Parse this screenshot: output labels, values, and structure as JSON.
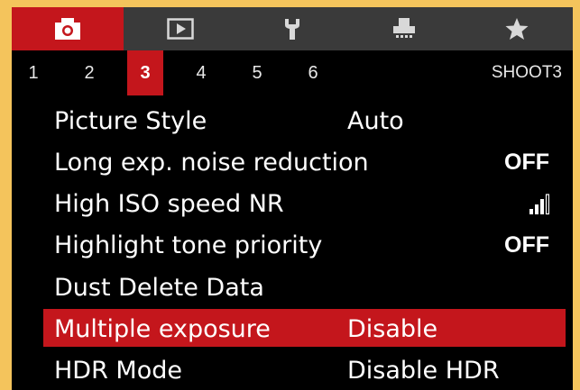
{
  "tabs": [
    {
      "icon": "camera-icon",
      "active": true
    },
    {
      "icon": "playback-icon",
      "active": false
    },
    {
      "icon": "wrench-icon",
      "active": false
    },
    {
      "icon": "custom-functions-icon",
      "active": false
    },
    {
      "icon": "star-icon",
      "active": false
    }
  ],
  "pages": {
    "numbers": [
      "1",
      "2",
      "3",
      "4",
      "5",
      "6"
    ],
    "active_index": 2,
    "section_label": "SHOOT3"
  },
  "menu": {
    "items": [
      {
        "label": "Picture Style",
        "value": "Auto"
      },
      {
        "label": "Long exp. noise reduction",
        "value": "OFF"
      },
      {
        "label": "High ISO speed NR",
        "value_icon": "nr-level-icon",
        "level": 0.75
      },
      {
        "label": "Highlight tone priority",
        "value": "OFF"
      },
      {
        "label": "Dust Delete Data",
        "value": ""
      },
      {
        "label": "Multiple exposure",
        "value": "Disable",
        "selected": true
      },
      {
        "label": "HDR Mode",
        "value": "Disable HDR"
      }
    ]
  },
  "colors": {
    "accent": "#c4161c",
    "background": "#000000",
    "frame": "#f4c45c"
  }
}
